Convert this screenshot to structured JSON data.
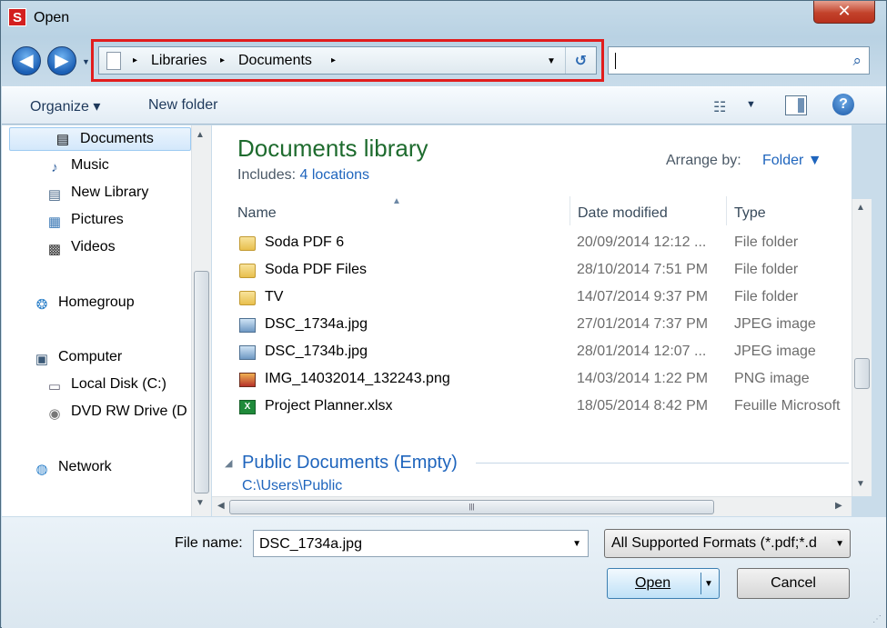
{
  "window": {
    "title": "Open",
    "app_icon_letter": "S",
    "close_glyph": "✕"
  },
  "address_bar": {
    "crumbs": [
      "Libraries",
      "Documents"
    ],
    "separator": "▸",
    "dropdown_glyph": "▼",
    "refresh_glyph": "↺"
  },
  "search": {
    "value": "",
    "icon": "search-icon"
  },
  "toolbar": {
    "organize": "Organize ▾",
    "new_folder": "New folder",
    "view_icon": "details-view-icon",
    "view_drop": "▼",
    "help": "?"
  },
  "nav_pane": {
    "items": [
      {
        "label": "Documents",
        "icon": "📄"
      },
      {
        "label": "Music",
        "icon": "♪"
      },
      {
        "label": "New Library",
        "icon": "▤"
      },
      {
        "label": "Pictures",
        "icon": "▦"
      },
      {
        "label": "Videos",
        "icon": "▩"
      },
      {
        "label": "Homegroup",
        "icon": "❂"
      },
      {
        "label": "Computer",
        "icon": "▣"
      },
      {
        "label": "Local Disk (C:)",
        "icon": "▭"
      },
      {
        "label": "DVD RW Drive (D",
        "icon": "◉"
      },
      {
        "label": "Network",
        "icon": "◍"
      }
    ]
  },
  "library": {
    "title": "Documents library",
    "includes_label": "Includes:",
    "includes_link": "4 locations",
    "arrange_label": "Arrange by:",
    "arrange_value": "Folder ▼"
  },
  "columns": {
    "name": "Name",
    "date": "Date modified",
    "type": "Type",
    "sort_glyph": "▲"
  },
  "files": [
    {
      "name": "Soda PDF 6",
      "date": "20/09/2014 12:12 ...",
      "type": "File folder",
      "kind": "folder"
    },
    {
      "name": "Soda PDF Files",
      "date": "28/10/2014 7:51 PM",
      "type": "File folder",
      "kind": "folder"
    },
    {
      "name": "TV",
      "date": "14/07/2014 9:37 PM",
      "type": "File folder",
      "kind": "folder"
    },
    {
      "name": "DSC_1734a.jpg",
      "date": "27/01/2014 7:37 PM",
      "type": "JPEG image",
      "kind": "jpg"
    },
    {
      "name": "DSC_1734b.jpg",
      "date": "28/01/2014 12:07 ...",
      "type": "JPEG image",
      "kind": "jpg"
    },
    {
      "name": "IMG_14032014_132243.png",
      "date": "14/03/2014 1:22 PM",
      "type": "PNG image",
      "kind": "png"
    },
    {
      "name": "Project Planner.xlsx",
      "date": "18/05/2014 8:42 PM",
      "type": "Feuille Microsoft",
      "kind": "xlsx"
    }
  ],
  "public_group": {
    "title": "Public Documents (Empty)",
    "path": "C:\\Users\\Public",
    "toggle": "◢"
  },
  "bottom": {
    "file_name_label": "File name:",
    "file_name_value": "DSC_1734a.jpg",
    "filter_value": "All Supported Formats (*.pdf;*.d",
    "open_label": "Open",
    "cancel_label": "Cancel",
    "dropdown_glyph": "▼"
  },
  "colors": {
    "highlight_outline": "#e11d1d",
    "link": "#1f65bd",
    "library_title": "#1e6b2e"
  }
}
